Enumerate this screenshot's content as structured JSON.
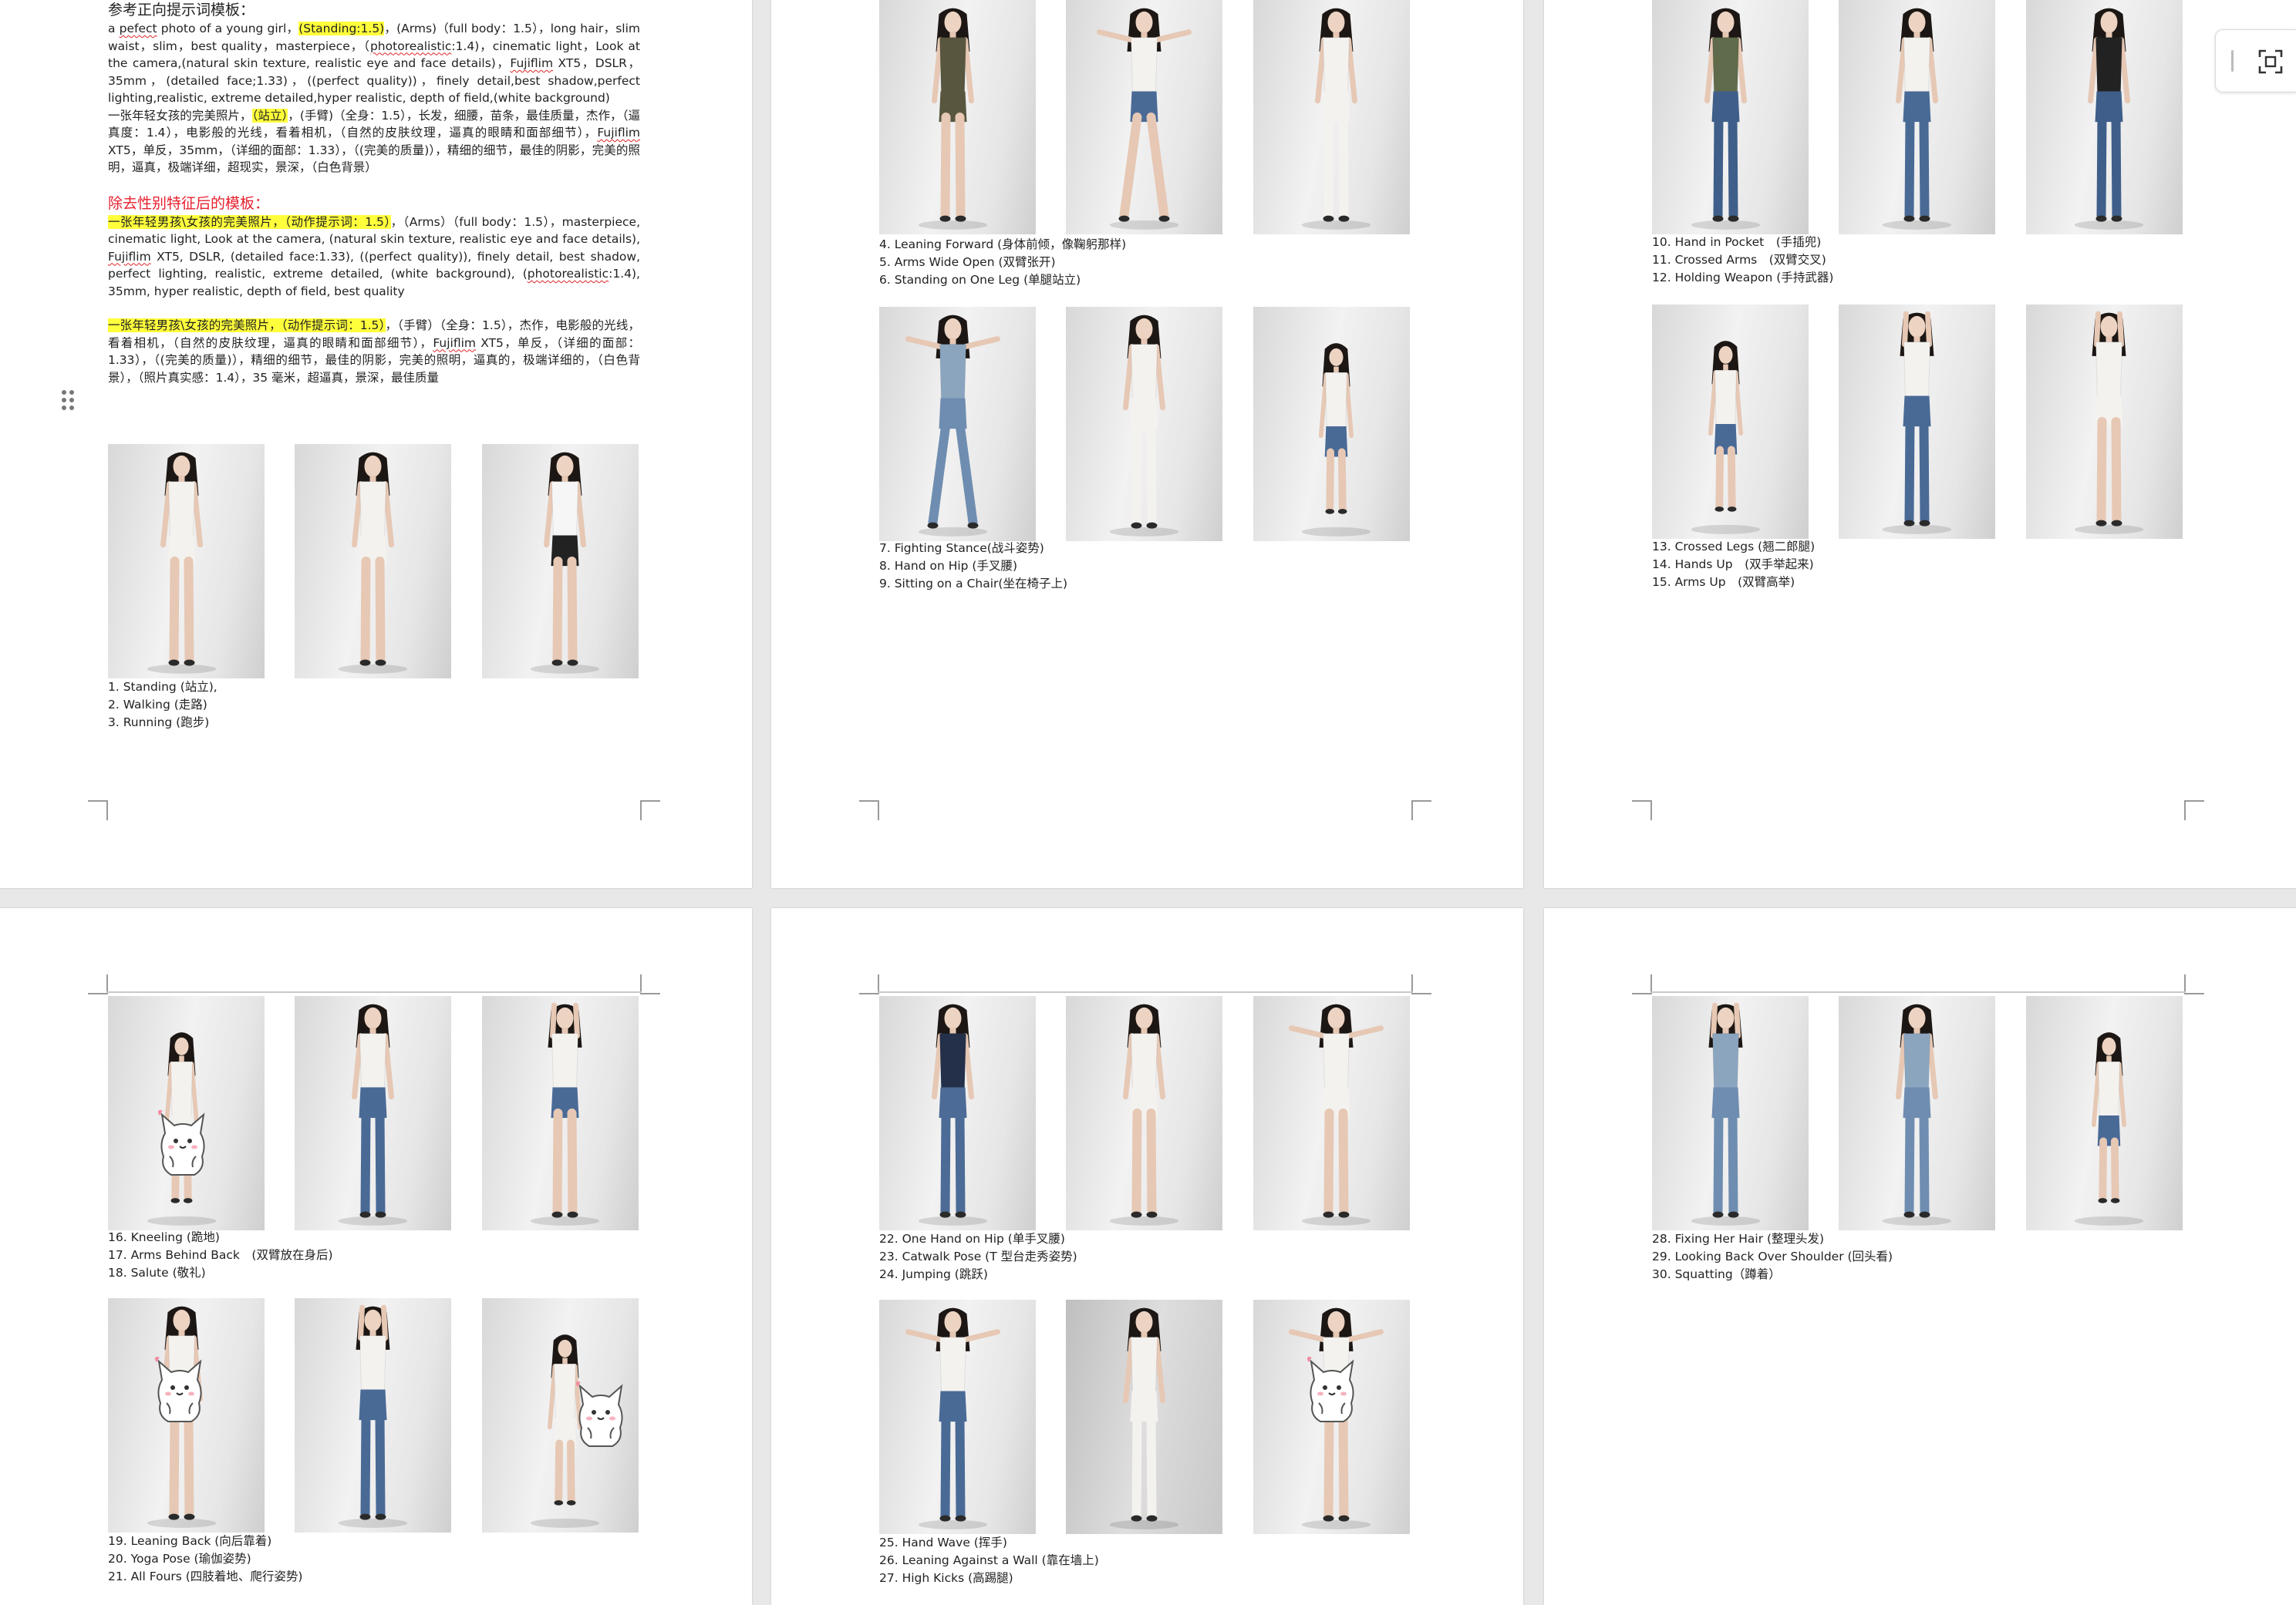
{
  "document": {
    "pages": [
      {
        "positive_title": "参考正向提示词模板：",
        "para1": {
          "a": "a ",
          "b": "pefect",
          "c": " photo of a young girl，",
          "d": "(Standing:1.5)",
          "e": "，(Arms)（full body：1.5），long hair，slim waist，slim，best quality，masterpiece，（",
          "f": "photorealistic",
          "g": ":1.4)，cinematic light，Look at the camera,(natural skin texture, realistic eye and face details)，",
          "h": "Fujiflim",
          "i": " XT5，DSLR，35mm，(detailed face;1.33)，((perfect quality))，finely detail,best shadow,perfect lighting,realistic, extreme detailed,hyper realistic, depth of field,(white background)"
        },
        "para2": {
          "a": "一张年轻女孩的完美照片，",
          "b": "（站立）",
          "c": "，(手臂)（全身：1.5），长发，细腰，苗条，最佳质量，杰作，（逼真度：1.4），电影般的光线，看着相机，（自然的皮肤纹理，逼真的眼睛和面部细节），",
          "d": "Fujiflim",
          "e": " XT5，单反，35mm，（详细的面部：1.33），（(完美的质量)），精细的细节，最佳的阴影，完美的照明，逼真，极端详细，超现实，景深，（白色背景）"
        },
        "neutral_title": "除去性别特征后的模板：",
        "para3": {
          "a": "一张年轻男孩\\女孩的完美照片，（动作提示词：1.5）",
          "b": "，（Arms）（full body：1.5），masterpiece, cinematic light, Look at the camera, (natural skin texture, realistic eye and face details), ",
          "c": "Fujiflim",
          "d": " XT5, DSLR, (detailed face:1.33), ((perfect quality)), finely detail, best shadow, perfect lighting, realistic, extreme detailed, (white background), (",
          "e": "photorealistic",
          "f": ":1.4), 35mm, hyper realistic, depth of field, best quality"
        },
        "para4": {
          "a": "一张年轻男孩\\女孩的完美照片，（动作提示词：1.5）",
          "b": "，（手臂）（全身：1.5），杰作，电影般的光线，看着相机，（自然的皮肤纹理，逼真的眼睛和面部细节），",
          "c": "Fujiflim",
          "d": " XT5，单反，（详细的面部：1.33），（(完美的质量)），精细的细节，最佳的阴影，完美的照明，逼真的，极端详细的，（白色背景），（照片真实感：1.4），35 毫米，超逼真，景深，最佳质量"
        }
      }
    ],
    "captions": {
      "g1": [
        "1. Standing (站立),",
        "2. Walking (走路)",
        "3. Running (跑步)"
      ],
      "g2": [
        "4. Leaning Forward (身体前倾，像鞠躬那样)",
        "5. Arms Wide Open (双臂张开)",
        "6. Standing on One Leg (单腿站立)"
      ],
      "g3": [
        "7. Fighting Stance(战斗姿势)",
        "8. Hand on Hip (手叉腰)",
        "9. Sitting on a Chair(坐在椅子上)"
      ],
      "g4": [
        "10. Hand in Pocket　(手插兜)",
        "11. Crossed Arms　(双臂交叉)",
        "12. Holding Weapon (手持武器)"
      ],
      "g5": [
        "13. Crossed Legs (翘二郎腿)",
        "14. Hands Up　(双手举起来)",
        "15. Arms Up　(双臂高举)"
      ],
      "g6": [
        "16. Kneeling (跪地)",
        "17. Arms Behind Back　(双臂放在身后)",
        "18. Salute (敬礼)"
      ],
      "g7": [
        "19. Leaning Back (向后靠着)",
        "20. Yoga Pose (瑜伽姿势)",
        "21. All Fours (四肢着地、爬行姿势)"
      ],
      "g8": [
        "22. One Hand on Hip (单手叉腰)",
        "23. Catwalk Pose (T 型台走秀姿势)",
        "24. Jumping (跳跃)"
      ],
      "g9": [
        "25. Hand Wave (挥手)",
        "26. Leaning Against a Wall (靠在墙上)",
        "27. High Kicks (高踢腿)"
      ],
      "g10": [
        "28. Fixing Her Hair (整理头发)",
        "29. Looking Back Over Shoulder (回头看)",
        "30. Squatting（蹲着）"
      ]
    },
    "photos": [
      {
        "outfit": "white-dress",
        "pose": "standing"
      },
      {
        "outfit": "white-long-sleeve-dress",
        "pose": "walking"
      },
      {
        "outfit": "tee-black-shorts",
        "pose": "running"
      },
      {
        "outfit": "olive-mini",
        "pose": "leaning-forward"
      },
      {
        "outfit": "crop-top-denim-shorts",
        "pose": "arms-wide"
      },
      {
        "outfit": "white-jumpsuit",
        "pose": "one-leg"
      },
      {
        "outfit": "blue-jumpsuit",
        "pose": "fighting-stance"
      },
      {
        "outfit": "white-pants",
        "pose": "hand-on-hip"
      },
      {
        "outfit": "white-tee-denim-shorts",
        "pose": "sitting-chair"
      },
      {
        "outfit": "green-jacket-jeans",
        "pose": "hand-in-pocket"
      },
      {
        "outfit": "white-tee-jeans",
        "pose": "crossed-arms"
      },
      {
        "outfit": "black-top-jeans",
        "pose": "holding-weapon"
      },
      {
        "outfit": "denim-shirt",
        "pose": "crossed-legs"
      },
      {
        "outfit": "denim-jacket-jeans",
        "pose": "hands-up"
      },
      {
        "outfit": "white-crop-shorts",
        "pose": "arms-up"
      },
      {
        "outfit": "white-top",
        "pose": "kneeling"
      },
      {
        "outfit": "white-tank-jeans",
        "pose": "arms-behind-back"
      },
      {
        "outfit": "white-tee-denim-shorts",
        "pose": "salute"
      },
      {
        "outfit": "white-top-shorts",
        "pose": "leaning-back"
      },
      {
        "outfit": "crop-top-jeans",
        "pose": "yoga"
      },
      {
        "outfit": "white-tank",
        "pose": "all-fours"
      },
      {
        "outfit": "navy-cardigan-jeans",
        "pose": "hand-on-hip"
      },
      {
        "outfit": "white-crop-shorts",
        "pose": "catwalk"
      },
      {
        "outfit": "white-dress",
        "pose": "jumping"
      },
      {
        "outfit": "white-tee-jeans",
        "pose": "hand-wave"
      },
      {
        "outfit": "white-outfit",
        "pose": "leaning-wall"
      },
      {
        "outfit": "white-top-shorts",
        "pose": "high-kick"
      },
      {
        "outfit": "blue-crop-jeans",
        "pose": "fixing-hair"
      },
      {
        "outfit": "blue-top-jeans",
        "pose": "looking-back"
      },
      {
        "outfit": "white-top-denim-shorts",
        "pose": "squatting"
      }
    ],
    "colors": {
      "highlight": "#ffff3c",
      "red_title": "#e6202e",
      "spell_underline": "#e02424",
      "page_bg": "#e8e8e8"
    },
    "icons": [
      "drag-handle-icon",
      "screenshot-icon"
    ]
  }
}
